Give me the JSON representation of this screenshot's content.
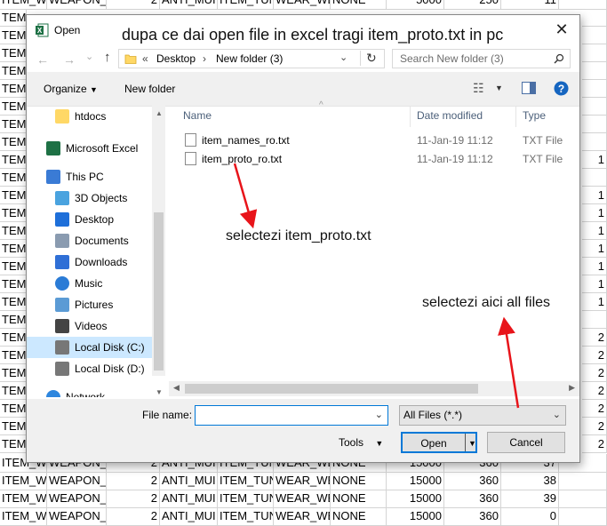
{
  "sheet": {
    "rows": [
      [
        "ITEM_WE",
        "WEAPON_",
        "2",
        "ANTI_MUI",
        "ITEM_TUN",
        "WEAR_WE",
        "NONE",
        "5000",
        "250",
        "11"
      ],
      [
        "ITEM_WE",
        "WEAPON_",
        "2",
        "ANTI_MUI",
        "ITEM_TUN",
        "WEAR_WE",
        "NONE",
        "15000",
        "360",
        "37"
      ],
      [
        "ITEM_WE",
        "WEAPON_",
        "2",
        "ANTI_MUI",
        "ITEM_TUN",
        "WEAR_WE",
        "NONE",
        "15000",
        "360",
        "38"
      ],
      [
        "ITEM_WE",
        "WEAPON_",
        "2",
        "ANTI_MUI",
        "ITEM_TUN",
        "WEAR_WE",
        "NONE",
        "15000",
        "360",
        "39"
      ],
      [
        "ITEM_WE",
        "WEAPON_",
        "2",
        "ANTI_MUI",
        "ITEM_TUN",
        "WEAR_WE",
        "NONE",
        "15000",
        "360",
        "0"
      ]
    ],
    "side_col": [
      "",
      "",
      "",
      "",
      "",
      "",
      "",
      "",
      "1",
      "",
      "1",
      "1",
      "1",
      "1",
      "1",
      "1",
      "1",
      "",
      "2",
      "2",
      "2",
      "2",
      "2",
      "2",
      "2",
      "2",
      "2",
      "2",
      "2",
      "2"
    ],
    "left_col": "TEM_"
  },
  "dialog": {
    "title": "Open",
    "address": [
      "«",
      "Desktop",
      "›",
      "New folder (3)"
    ],
    "search_placeholder": "Search New folder (3)",
    "toolbar": {
      "organize": "Organize",
      "new_folder": "New folder"
    },
    "nav": [
      {
        "label": "htdocs",
        "icon": "folder-icon"
      },
      {
        "label": "Microsoft Excel",
        "icon": "excel-icon"
      },
      {
        "label": "This PC",
        "icon": "computer-icon"
      },
      {
        "label": "3D Objects",
        "icon": "cube-icon"
      },
      {
        "label": "Desktop",
        "icon": "desktop-icon"
      },
      {
        "label": "Documents",
        "icon": "documents-icon"
      },
      {
        "label": "Downloads",
        "icon": "download-icon"
      },
      {
        "label": "Music",
        "icon": "music-icon"
      },
      {
        "label": "Pictures",
        "icon": "pictures-icon"
      },
      {
        "label": "Videos",
        "icon": "videos-icon"
      },
      {
        "label": "Local Disk (C:)",
        "icon": "drive-icon"
      },
      {
        "label": "Local Disk (D:)",
        "icon": "drive-icon"
      },
      {
        "label": "Network",
        "icon": "network-icon"
      }
    ],
    "columns": {
      "name": "Name",
      "date": "Date modified",
      "type": "Type"
    },
    "files": [
      {
        "name": "item_names_ro.txt",
        "date": "11-Jan-19 11:12",
        "type": "TXT File"
      },
      {
        "name": "item_proto_ro.txt",
        "date": "11-Jan-19 11:12",
        "type": "TXT File"
      }
    ],
    "file_name_label": "File name:",
    "file_name_value": "",
    "file_type_value": "All Files (*.*)",
    "tools": "Tools",
    "open": "Open",
    "cancel": "Cancel"
  },
  "annotations": {
    "top": "dupa ce dai open file in excel tragi item_proto.txt in pc",
    "middle": "selectezi item_proto.txt",
    "right": "selectezi aici all files"
  },
  "colors": {
    "arrow": "#e8141a",
    "accent": "#0063b1",
    "selection": "#cce8ff",
    "highlight_nav": "#e5f3ff"
  }
}
